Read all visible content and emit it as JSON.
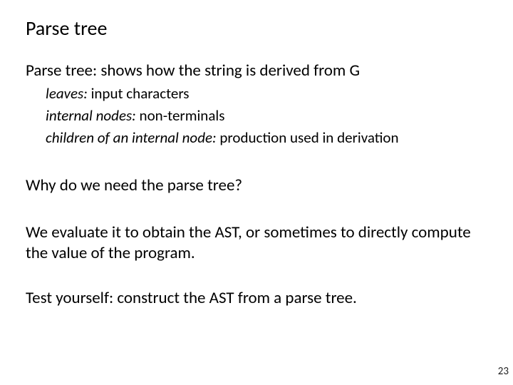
{
  "title": "Parse tree",
  "p1": "Parse tree: shows how the string is derived from G",
  "b1_pre": "leaves:",
  "b1_post": " input characters",
  "b2_pre": "internal nodes:",
  "b2_post": " non-terminals",
  "b3_pre": "children of an internal node:",
  "b3_post": " production used in derivation",
  "p2": "Why do we need the parse tree?",
  "p3": "We evaluate it to obtain the AST, or sometimes to directly compute the value of the program.",
  "p4": "Test yourself: construct the AST from a parse tree.",
  "pageNumber": "23"
}
